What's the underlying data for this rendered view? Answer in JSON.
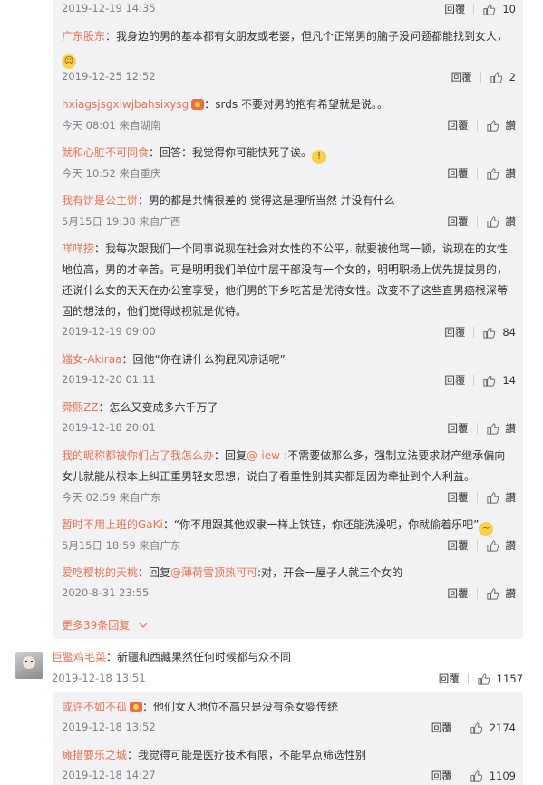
{
  "icons": {
    "like": "thumbs-up-icon",
    "more": "chevron-down-icon",
    "vip": "vip-badge-icon",
    "emoji": "emoji-icon"
  },
  "reply_label": "回覆",
  "comments": [
    {
      "meta": "2019-12-19 14:35",
      "likes": "10"
    },
    {
      "user": "广东股东",
      "text": "：我身边的男的基本都有女朋友或老婆，但凡个正常男的脑子没问题都能找到女人，",
      "meta": "2019-12-25 12:52",
      "likes": "2"
    },
    {
      "user": "hxiagsjsgxiwjbahsixysg",
      "text": "：srds 不要对男的抱有希望就是说。。",
      "meta": "今天 08:01 来自湖南",
      "likes": "讃"
    },
    {
      "user": "鱿和心脏不可同食",
      "text": "：回答：我觉得你可能快死了诶。",
      "meta": "今天 10:52 来自重庆",
      "likes": "讃"
    },
    {
      "user": "我有饼是公主饼",
      "text": "：男的都是共情很差的 觉得这是理所当然 并没有什么",
      "meta": "5月15日 19:38 来自广西",
      "likes": "讃"
    },
    {
      "user": "咩咩捞",
      "text": "：我每次跟我们一个同事说现在社会对女性的不公平，就要被他骂一顿，说现在的女性地位高，男的才辛苦。可是明明我们单位中层干部没有一个女的，明明职场上优先提拔男的，还说什么女的天天在办公室享受，他们男的下乡吃苦是优待女性。改变不了这些直男癌根深蒂固的想法的，他们觉得歧视就是优待。",
      "meta": "2019-12-19 09:00",
      "likes": "84"
    },
    {
      "user": "媸女-Akiraa",
      "text": "：回他“你在讲什么狗屁风凉话呢”",
      "meta": "2019-12-20 01:11",
      "likes": "14"
    },
    {
      "user": "舜熙ZZ",
      "text": "：怎么又变成多六千万了",
      "meta": "2019-12-18 20:01",
      "likes": "讃"
    },
    {
      "user": "我的昵称都被你们占了我怎么办",
      "text_pre": "：回复",
      "at": "@-iew-",
      "text": ":不需要做那么多，强制立法要求财产继承偏向女儿就能从根本上纠正重男轻女思想，说白了看重性别其实都是因为牵扯到个人利益。",
      "meta": "今天 02:59 来自广东",
      "likes": "讃"
    },
    {
      "user": "暂时不用上班的GaKi",
      "text": "：“你不用跟其他奴隶一样上铁链，你还能洗澡呢，你就偷着乐吧”",
      "meta": "5月15日 18:59 来自广东",
      "likes": "讃"
    },
    {
      "user": "爱吃樱桃的天桃",
      "text_pre": "：回复",
      "at": "@薄荷雪顶热可可",
      "text": ":对，开会一屋子人就三个女的",
      "meta": "2020-8-31 23:55",
      "likes": "讃"
    }
  ],
  "more_replies": "更多39条回复",
  "top_comment": {
    "user": "巨鳖鸡毛菜",
    "text": "：新疆和西藏果然任何时候都与众不同",
    "meta": "2019-12-18 13:51",
    "likes": "1157"
  },
  "replies2": [
    {
      "user": "或许不如不孤",
      "text": "：他们女人地位不高只是没有杀女婴传统",
      "meta": "2019-12-18 13:52",
      "likes": "2174"
    },
    {
      "user": "瘫措要乐之城",
      "text": "：我觉得可能是医疗技术有限，不能早点筛选性别",
      "meta": "2019-12-18 14:27",
      "likes": "1109"
    }
  ]
}
